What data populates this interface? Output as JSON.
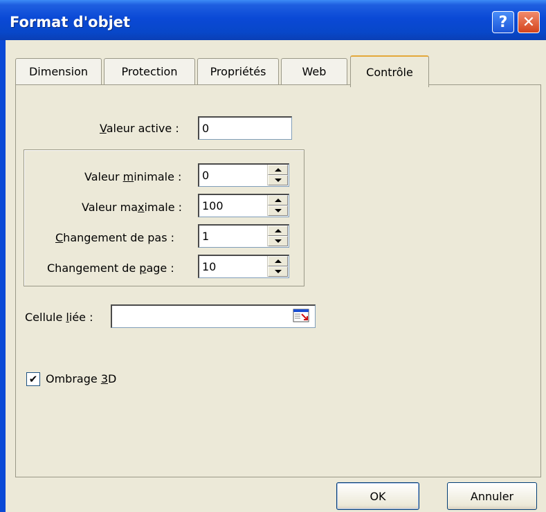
{
  "window": {
    "title": "Format d'objet",
    "help_label": "?",
    "close_label": "✕"
  },
  "tabs": [
    {
      "label": "Dimension",
      "active": false
    },
    {
      "label": "Protection",
      "active": false
    },
    {
      "label": "Propriétés",
      "active": false
    },
    {
      "label": "Web",
      "active": false
    },
    {
      "label": "Contrôle",
      "active": true
    }
  ],
  "control": {
    "current_value": {
      "label_before": "",
      "label_u": "V",
      "label_after": "aleur active :",
      "value": "0"
    },
    "min_value": {
      "label_before": "Valeur ",
      "label_u": "m",
      "label_after": "inimale :",
      "value": "0"
    },
    "max_value": {
      "label_before": "Valeur ma",
      "label_u": "x",
      "label_after": "imale :",
      "value": "100"
    },
    "step": {
      "label_before": "",
      "label_u": "C",
      "label_after": "hangement de pas :",
      "value": "1"
    },
    "page_change": {
      "label_before": "Changement de ",
      "label_u": "p",
      "label_after": "age :",
      "value": "10"
    },
    "linked_cell": {
      "label_before": "Cellule ",
      "label_u": "l",
      "label_after": "iée :",
      "value": ""
    },
    "shading_3d": {
      "label_before": "Ombrage ",
      "label_u": "3",
      "label_after": "D",
      "checked": true,
      "check_mark": "✔"
    }
  },
  "buttons": {
    "ok": "OK",
    "cancel": "Annuler"
  },
  "icons": {
    "help": "help-icon",
    "close": "close-icon",
    "collapse_dialog": "collapse-dialog-icon"
  }
}
